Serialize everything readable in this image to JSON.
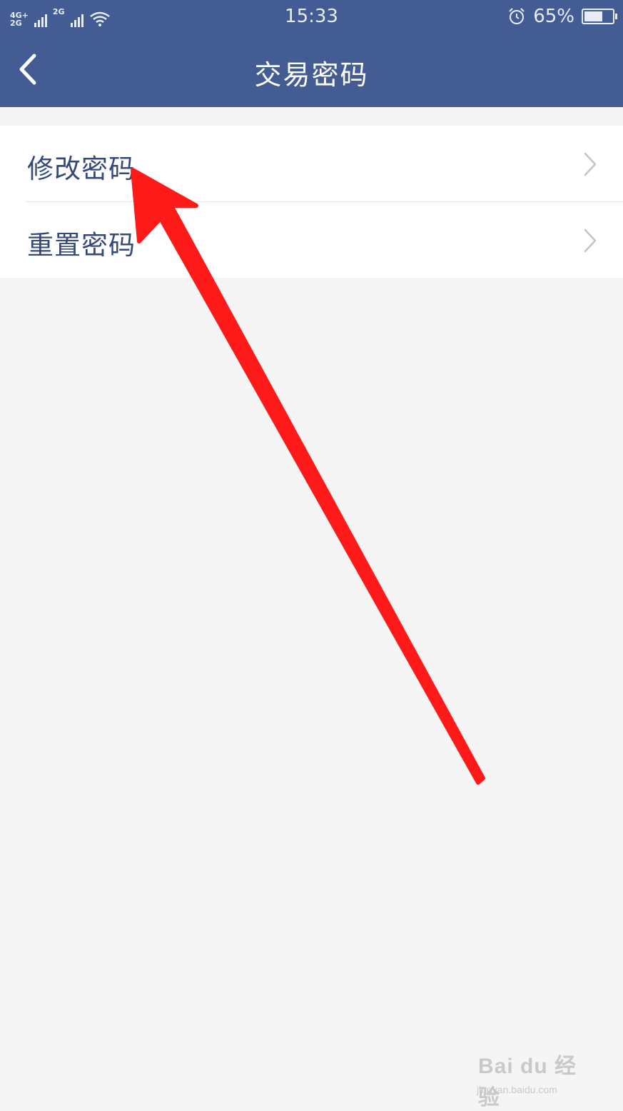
{
  "status_bar": {
    "network1": "4G+",
    "network1b": "2G",
    "network2": "2G",
    "time": "15:33",
    "battery_percent": "65%",
    "battery_level": 0.65,
    "icons": [
      "signal-icon",
      "wifi-icon",
      "alarm-icon",
      "battery-icon"
    ]
  },
  "header": {
    "title": "交易密码",
    "back_icon": "chevron-left-icon",
    "background_color": "#435c93"
  },
  "menu": {
    "items": [
      {
        "label": "修改密码",
        "icon": "chevron-right-icon"
      },
      {
        "label": "重置密码",
        "icon": "chevron-right-icon"
      }
    ]
  },
  "annotation": {
    "color": "#ff1a1a",
    "icon": "red-arrow-pointer"
  },
  "watermark": {
    "brand": "Bai du 经验",
    "url": "jingyan.baidu.com"
  }
}
